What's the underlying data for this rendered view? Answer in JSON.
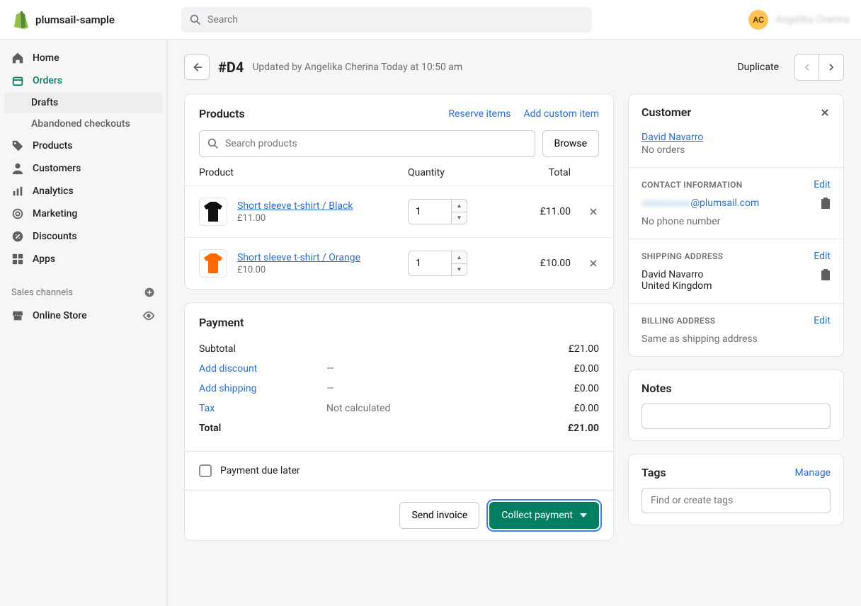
{
  "header": {
    "store_name": "plumsail-sample",
    "search_placeholder": "Search",
    "avatar_initials": "AC",
    "user_name": "Angelika Cherina"
  },
  "sidebar": {
    "items": [
      {
        "label": "Home"
      },
      {
        "label": "Orders"
      },
      {
        "label": "Products"
      },
      {
        "label": "Customers"
      },
      {
        "label": "Analytics"
      },
      {
        "label": "Marketing"
      },
      {
        "label": "Discounts"
      },
      {
        "label": "Apps"
      }
    ],
    "orders_sub": [
      {
        "label": "Drafts",
        "active": true
      },
      {
        "label": "Abandoned checkouts",
        "active": false
      }
    ],
    "channels_heading": "Sales channels",
    "channel_item": "Online Store"
  },
  "page": {
    "draft_id": "#D4",
    "updated_text": "Updated by Angelika Cherina Today at 10:50 am",
    "duplicate": "Duplicate"
  },
  "products_card": {
    "title": "Products",
    "reserve": "Reserve items",
    "add_custom": "Add custom item",
    "search_placeholder": "Search products",
    "browse": "Browse",
    "headers": {
      "product": "Product",
      "quantity": "Quantity",
      "total": "Total"
    },
    "rows": [
      {
        "name": "Short sleeve t-shirt / Black",
        "price": "£11.00",
        "qty": "1",
        "total": "£11.00",
        "swatch": "#111"
      },
      {
        "name": "Short sleeve t-shirt / Orange",
        "price": "£10.00",
        "qty": "1",
        "total": "£10.00",
        "swatch": "#ff6a00"
      }
    ]
  },
  "payment_card": {
    "title": "Payment",
    "rows": {
      "subtotal": {
        "label": "Subtotal",
        "value": "£21.00"
      },
      "discount": {
        "label": "Add discount",
        "mid": "—",
        "value": "£0.00"
      },
      "shipping": {
        "label": "Add shipping",
        "mid": "—",
        "value": "£0.00"
      },
      "tax": {
        "label": "Tax",
        "mid": "Not calculated",
        "value": "£0.00"
      },
      "total": {
        "label": "Total",
        "value": "£21.00"
      }
    },
    "due_later": "Payment due later",
    "send_invoice": "Send invoice",
    "collect": "Collect payment"
  },
  "customer": {
    "title": "Customer",
    "name": "David Navarro",
    "order_count": "No orders",
    "contact_heading": "CONTACT INFORMATION",
    "email_hidden": "xxxxxxxxxx",
    "email_domain": "@plumsail.com",
    "no_phone": "No phone number",
    "shipping_heading": "SHIPPING ADDRESS",
    "ship_name": "David Navarro",
    "ship_country": "United Kingdom",
    "billing_heading": "BILLING ADDRESS",
    "billing_same": "Same as shipping address",
    "edit": "Edit"
  },
  "notes": {
    "title": "Notes"
  },
  "tags": {
    "title": "Tags",
    "manage": "Manage",
    "placeholder": "Find or create tags"
  }
}
